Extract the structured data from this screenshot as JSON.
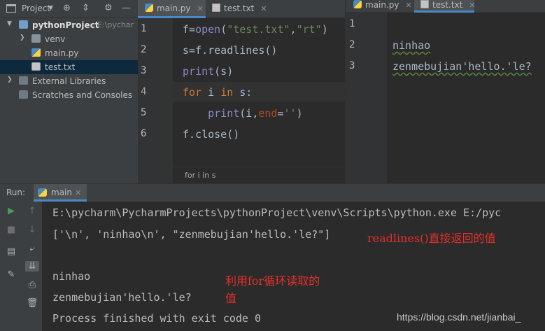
{
  "project_panel": {
    "title": "Project",
    "tree": [
      {
        "label": "pythonProject",
        "path": "E:\\pychar"
      },
      {
        "label": "venv"
      },
      {
        "label": "main.py"
      },
      {
        "label": "test.txt"
      },
      {
        "label": "External Libraries"
      },
      {
        "label": "Scratches and Consoles"
      }
    ]
  },
  "editor_left": {
    "tabs": [
      {
        "label": "main.py",
        "active": true
      },
      {
        "label": "test.txt",
        "active": false
      }
    ],
    "line_numbers": [
      "1",
      "2",
      "3",
      "4",
      "5",
      "6"
    ],
    "lines": [
      "f=open(\"test.txt\",\"rt\")",
      "s=f.readlines()",
      "print(s)",
      "for i in s:",
      "    print(i,end='')",
      "f.close()"
    ],
    "breadcrumb": "for i in s"
  },
  "editor_right": {
    "tabs": [
      {
        "label": "main.py",
        "active": false
      },
      {
        "label": "test.txt",
        "active": true
      }
    ],
    "line_numbers": [
      "1",
      "2",
      "3"
    ],
    "lines": [
      "",
      "ninhao",
      "zenmebujian'hello.'le?"
    ]
  },
  "run_panel": {
    "label": "Run:",
    "tab": "main",
    "output": [
      "E:\\pycharm\\PycharmProjects\\pythonProject\\venv\\Scripts\\python.exe E:/pyc",
      "['\\n', 'ninhao\\n', \"zenmebujian'hello.'le?\"]",
      "",
      "ninhao",
      "zenmebujian'hello.'le?",
      "Process finished with exit code 0"
    ],
    "annotations": [
      "readlines()直接返回的值",
      "利用for循环读取的",
      "值"
    ]
  },
  "watermark": "https://blog.csdn.net/jianbai_",
  "colors": {
    "keyword": "#cc7832",
    "string": "#6a8759",
    "annotation": "#e4302a",
    "selection": "#0d293e"
  }
}
